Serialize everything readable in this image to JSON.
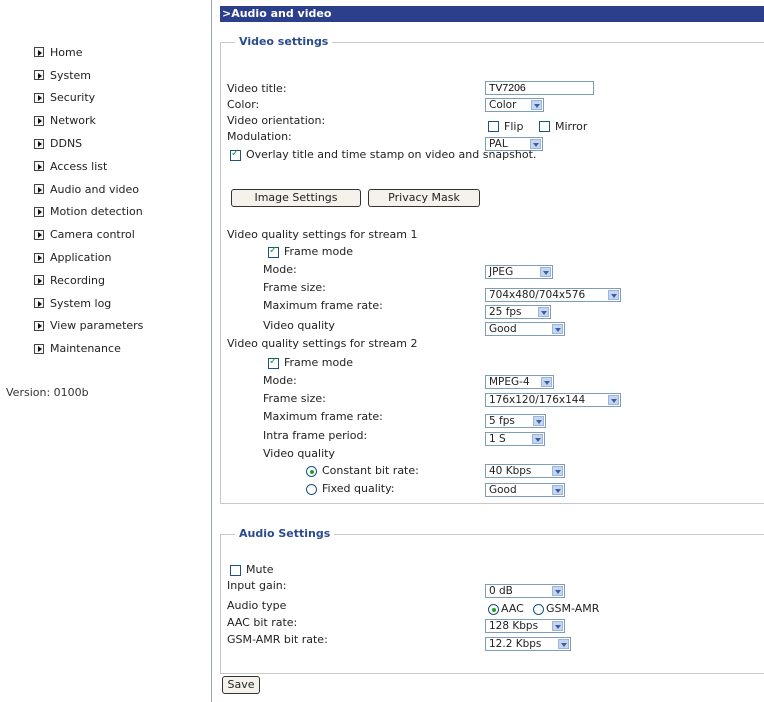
{
  "sidebar": {
    "items": [
      "Home",
      "System",
      "Security",
      "Network",
      "DDNS",
      "Access list",
      "Audio and video",
      "Motion detection",
      "Camera control",
      "Application",
      "Recording",
      "System log",
      "View parameters",
      "Maintenance"
    ],
    "version": "Version: 0100b"
  },
  "page_title": ">Audio and video",
  "video": {
    "legend": "Video settings",
    "title_label": "Video title:",
    "title_value": "TV7206",
    "color_label": "Color:",
    "color_value": "Color",
    "orientation_label": "Video orientation:",
    "flip_label": "Flip",
    "mirror_label": "Mirror",
    "flip_checked": false,
    "mirror_checked": false,
    "modulation_label": "Modulation:",
    "modulation_value": "PAL",
    "overlay_label": "Overlay title and time stamp on video and snapshot.",
    "overlay_checked": true,
    "image_settings_btn": "Image Settings",
    "privacy_mask_btn": "Privacy Mask",
    "stream1": {
      "heading": "Video quality settings for stream 1",
      "frame_mode_label": "Frame mode",
      "mode_label": "Mode:",
      "mode_value": "JPEG",
      "frame_size_label": "Frame size:",
      "frame_size_value": "704x480/704x576",
      "max_rate_label": "Maximum frame rate:",
      "max_rate_value": "25 fps",
      "quality_label": "Video quality",
      "quality_value": "Good"
    },
    "stream2": {
      "heading": "Video quality settings for stream 2",
      "frame_mode_label": "Frame mode",
      "mode_label": "Mode:",
      "mode_value": "MPEG-4",
      "frame_size_label": "Frame size:",
      "frame_size_value": "176x120/176x144",
      "max_rate_label": "Maximum frame rate:",
      "max_rate_value": "5 fps",
      "intra_label": "Intra frame period:",
      "intra_value": "1 S",
      "quality_label": "Video quality",
      "cbr_label": "Constant bit rate:",
      "cbr_value": "40 Kbps",
      "fixed_label": "Fixed quality:",
      "fixed_value": "Good",
      "selected_quality": "Constant bit rate"
    }
  },
  "audio": {
    "legend": "Audio Settings",
    "mute_label": "Mute",
    "mute_checked": false,
    "gain_label": "Input gain:",
    "gain_value": "0 dB",
    "type_label": "Audio type",
    "type_aac": "AAC",
    "type_gsm": "GSM-AMR",
    "type_selected": "AAC",
    "aac_rate_label": "AAC bit rate:",
    "aac_rate_value": "128 Kbps",
    "gsm_rate_label": "GSM-AMR bit rate:",
    "gsm_rate_value": "12.2 Kbps"
  },
  "save_label": "Save"
}
